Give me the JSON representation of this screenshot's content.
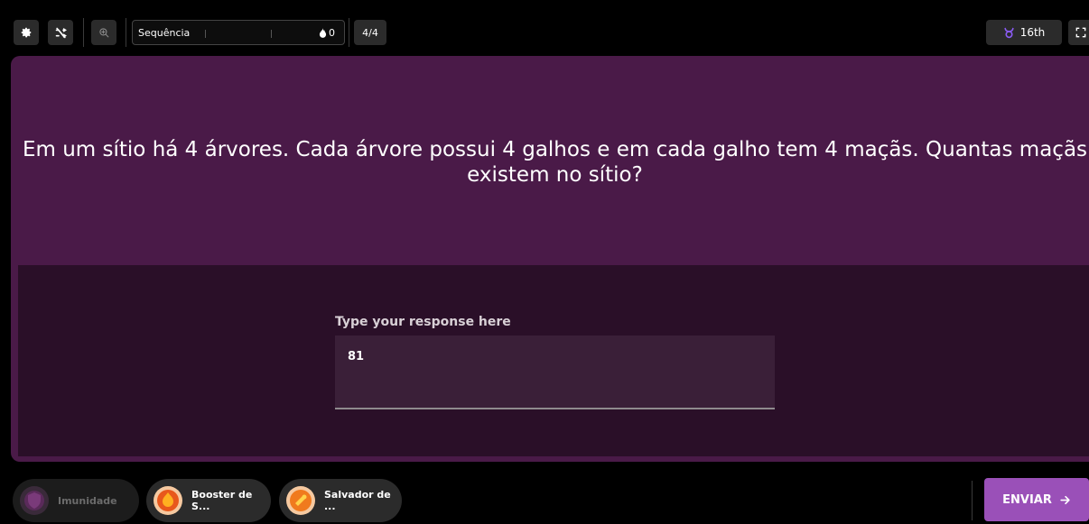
{
  "topbar": {
    "settings_icon": "gear-icon",
    "shuffle_icon": "shuffle-off-icon",
    "zoom_icon": "zoom-in-icon",
    "streak_label": "Sequência",
    "streak_count": "0",
    "question_count": "4/4",
    "rank": "16th",
    "rank_icon": "taurus-icon",
    "fullscreen_icon": "fullscreen-icon"
  },
  "question": {
    "text": "Em um sítio há 4 árvores. Cada árvore possui 4 galhos e em cada galho tem 4 maçãs. Quantas maçãs existem no sítio?"
  },
  "response": {
    "label": "Type your response here",
    "value": "81"
  },
  "powerups": [
    {
      "label": "Imunidade",
      "enabled": false
    },
    {
      "label": "Booster de S...",
      "enabled": true
    },
    {
      "label": "Salvador de ...",
      "enabled": true
    }
  ],
  "submit": {
    "label": "ENVIAR"
  },
  "colors": {
    "card": "#4a1a48",
    "answer_area": "#2a0f28",
    "submit": "#9a50b8",
    "rank_icon": "#8b5cf6"
  }
}
